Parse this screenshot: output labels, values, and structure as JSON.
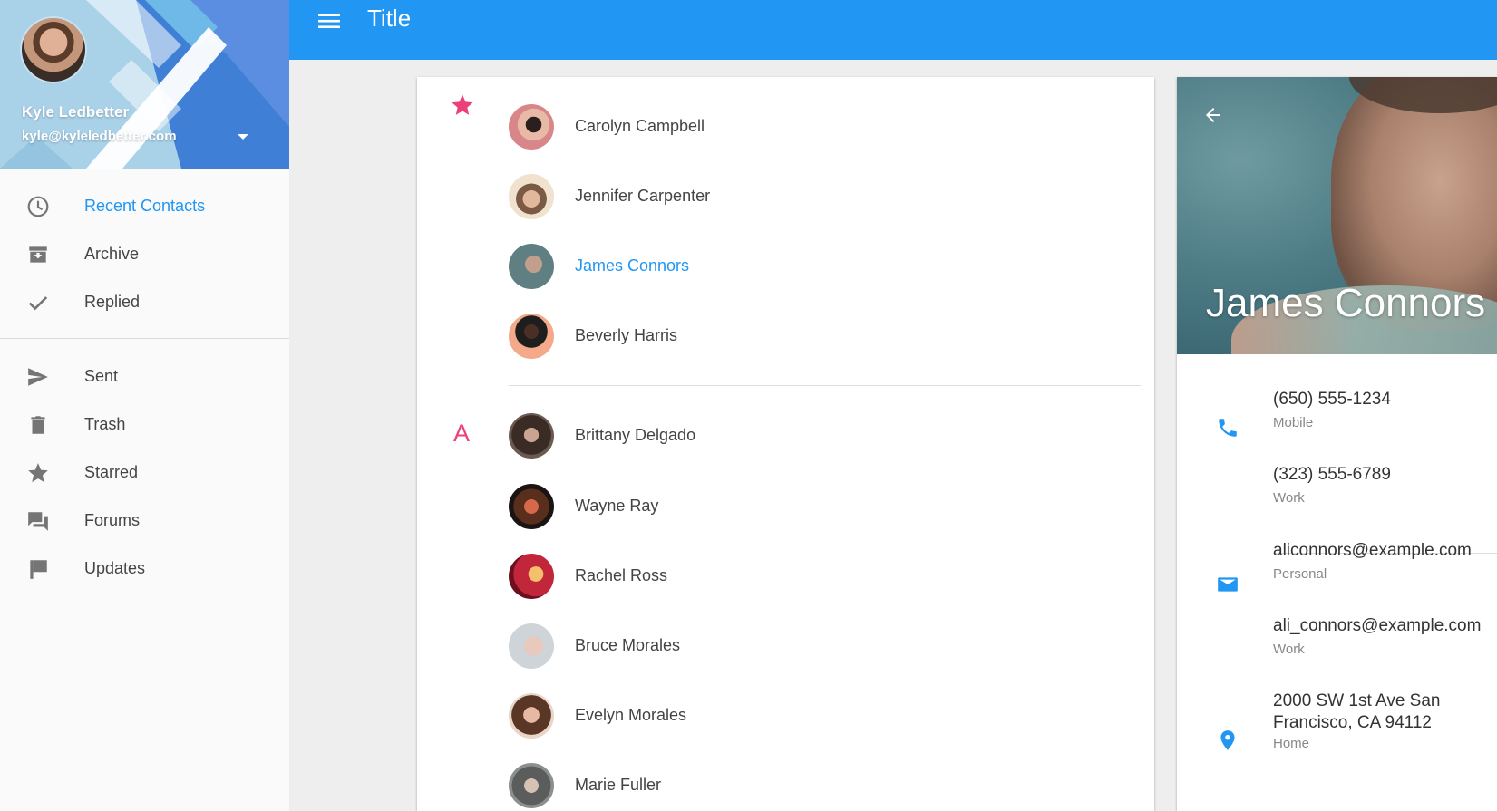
{
  "app_bar": {
    "title": "Title"
  },
  "account": {
    "name": "Kyle Ledbetter",
    "email": "kyle@kyleledbetter.com"
  },
  "sidebar": {
    "items": [
      {
        "label": "Recent Contacts",
        "icon": "clock-icon",
        "active": true
      },
      {
        "label": "Archive",
        "icon": "archive-icon"
      },
      {
        "label": "Replied",
        "icon": "check-icon"
      },
      {
        "label": "Sent",
        "icon": "send-icon"
      },
      {
        "label": "Trash",
        "icon": "trash-icon"
      },
      {
        "label": "Starred",
        "icon": "star-icon"
      },
      {
        "label": "Forums",
        "icon": "forum-icon"
      },
      {
        "label": "Updates",
        "icon": "flag-icon"
      }
    ]
  },
  "contacts": {
    "starred_group": [
      {
        "name": "Carolyn Campbell"
      },
      {
        "name": "Jennifer Carpenter"
      },
      {
        "name": "James Connors",
        "selected": true
      },
      {
        "name": "Beverly Harris"
      }
    ],
    "group_letter": "A",
    "letter_group": [
      {
        "name": "Brittany Delgado"
      },
      {
        "name": "Wayne Ray"
      },
      {
        "name": "Rachel Ross"
      },
      {
        "name": "Bruce Morales"
      },
      {
        "name": "Evelyn Morales"
      },
      {
        "name": "Marie Fuller"
      }
    ]
  },
  "detail": {
    "name": "James Connors",
    "phones": [
      {
        "number": "(650) 555-1234",
        "type": "Mobile"
      },
      {
        "number": "(323) 555-6789",
        "type": "Work"
      }
    ],
    "emails": [
      {
        "address": "aliconnors@example.com",
        "type": "Personal"
      },
      {
        "address": "ali_connors@example.com",
        "type": "Work"
      }
    ],
    "address": {
      "text": "2000 SW 1st Ave San Francisco, CA 94112",
      "type": "Home"
    }
  },
  "colors": {
    "primary": "#2196f3",
    "accent": "#ec407a",
    "icon_grey": "#757575"
  }
}
